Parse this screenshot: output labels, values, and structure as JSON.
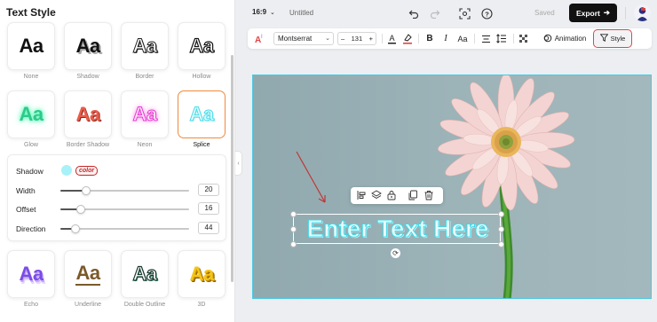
{
  "left_panel": {
    "title": "Text Style",
    "styles": [
      {
        "label": "None",
        "sample": "Aa"
      },
      {
        "label": "Shadow",
        "sample": "Aa"
      },
      {
        "label": "Border",
        "sample": "Aa"
      },
      {
        "label": "Hollow",
        "sample": "Aa"
      },
      {
        "label": "Glow",
        "sample": "Aa"
      },
      {
        "label": "Border Shadow",
        "sample": "Aa"
      },
      {
        "label": "Neon",
        "sample": "Aa"
      },
      {
        "label": "Splice",
        "sample": "Aa"
      },
      {
        "label": "Echo",
        "sample": "Aa"
      },
      {
        "label": "Underline",
        "sample": "Aa"
      },
      {
        "label": "Double Outline",
        "sample": "Aa"
      },
      {
        "label": "3D",
        "sample": "Aa"
      }
    ],
    "selected_style": "Splice",
    "settings": {
      "shadow_label": "Shadow",
      "shadow_color_tag": "color",
      "shadow_color": "#a8f1f8",
      "width_label": "Width",
      "width_value": "20",
      "width_fraction": 0.2,
      "offset_label": "Offset",
      "offset_value": "16",
      "offset_fraction": 0.16,
      "direction_label": "Direction",
      "direction_value": "44",
      "direction_fraction": 0.12
    }
  },
  "topbar": {
    "aspect_ratio": "16:9",
    "doc_title": "Untitled",
    "saved_label": "Saved",
    "export_label": "Export"
  },
  "toolbar": {
    "font_family": "Montserrat",
    "font_size": "131",
    "case_label": "Aa",
    "animation_label": "Animation",
    "style_label": "Style"
  },
  "canvas": {
    "text": "Enter Text Here"
  },
  "colors": {
    "accent_selected": "#ef8a3c",
    "export_bg": "#111111",
    "highlight_red": "#d84a4a",
    "canvas_border": "#4fc8e0"
  }
}
